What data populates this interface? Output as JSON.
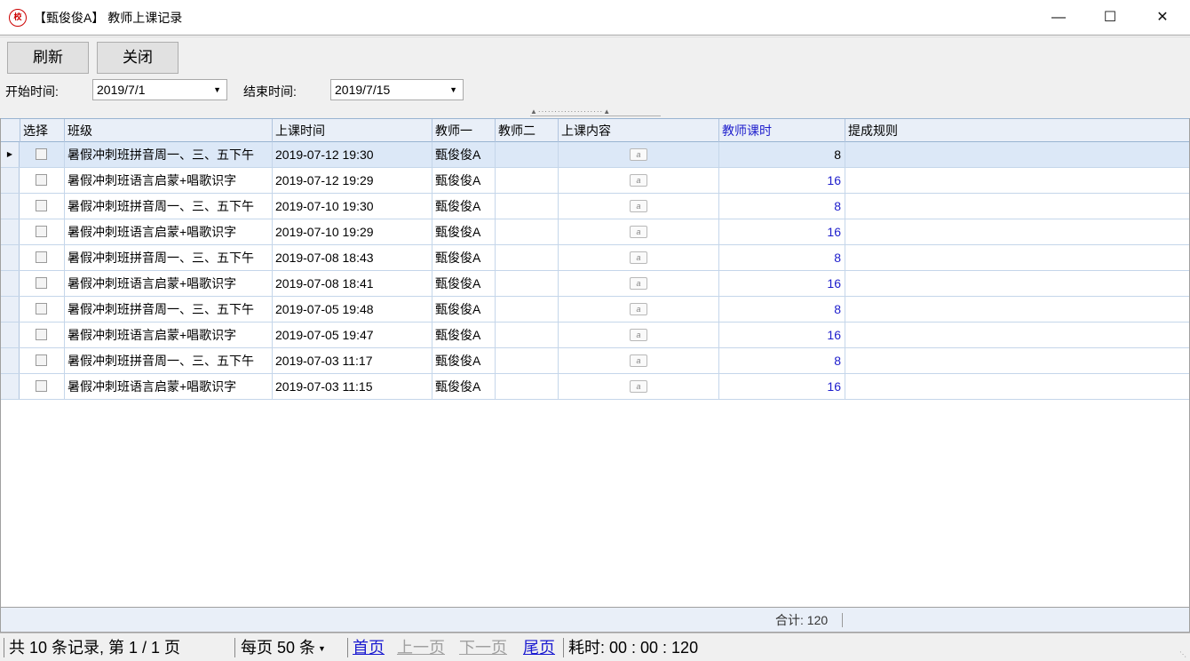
{
  "window": {
    "title": "【甄俊俊A】 教师上课记录",
    "icon_name": "app-logo-icon",
    "icon_text": "校"
  },
  "toolbar": {
    "refresh_label": "刷新",
    "close_label": "关闭"
  },
  "filters": {
    "start_label": "开始时间:",
    "start_value": "2019/7/1",
    "end_label": "结束时间:",
    "end_value": "2019/7/15"
  },
  "grid": {
    "columns": [
      "选择",
      "班级",
      "上课时间",
      "教师一",
      "教师二",
      "上课内容",
      "教师课时",
      "提成规则"
    ],
    "rows": [
      {
        "class": "暑假冲刺班拼音周一、三、五下午",
        "time": "2019-07-12 19:30",
        "teacher1": "甄俊俊A",
        "teacher2": "",
        "hours": "8",
        "rule": ""
      },
      {
        "class": "暑假冲刺班语言启蒙+唱歌识字",
        "time": "2019-07-12 19:29",
        "teacher1": "甄俊俊A",
        "teacher2": "",
        "hours": "16",
        "rule": ""
      },
      {
        "class": "暑假冲刺班拼音周一、三、五下午",
        "time": "2019-07-10 19:30",
        "teacher1": "甄俊俊A",
        "teacher2": "",
        "hours": "8",
        "rule": ""
      },
      {
        "class": "暑假冲刺班语言启蒙+唱歌识字",
        "time": "2019-07-10 19:29",
        "teacher1": "甄俊俊A",
        "teacher2": "",
        "hours": "16",
        "rule": ""
      },
      {
        "class": "暑假冲刺班拼音周一、三、五下午",
        "time": "2019-07-08 18:43",
        "teacher1": "甄俊俊A",
        "teacher2": "",
        "hours": "8",
        "rule": ""
      },
      {
        "class": "暑假冲刺班语言启蒙+唱歌识字",
        "time": "2019-07-08 18:41",
        "teacher1": "甄俊俊A",
        "teacher2": "",
        "hours": "16",
        "rule": ""
      },
      {
        "class": "暑假冲刺班拼音周一、三、五下午",
        "time": "2019-07-05 19:48",
        "teacher1": "甄俊俊A",
        "teacher2": "",
        "hours": "8",
        "rule": ""
      },
      {
        "class": "暑假冲刺班语言启蒙+唱歌识字",
        "time": "2019-07-05 19:47",
        "teacher1": "甄俊俊A",
        "teacher2": "",
        "hours": "16",
        "rule": ""
      },
      {
        "class": "暑假冲刺班拼音周一、三、五下午",
        "time": "2019-07-03 11:17",
        "teacher1": "甄俊俊A",
        "teacher2": "",
        "hours": "8",
        "rule": ""
      },
      {
        "class": "暑假冲刺班语言启蒙+唱歌识字",
        "time": "2019-07-03 11:15",
        "teacher1": "甄俊俊A",
        "teacher2": "",
        "hours": "16",
        "rule": ""
      }
    ],
    "selected_row": 0,
    "total_text": "合计: 120"
  },
  "pager": {
    "summary": "共 10 条记录, 第 1 / 1 页",
    "per_page": "每页 50 条",
    "first": "首页",
    "prev": "上一页",
    "next": "下一页",
    "last": "尾页",
    "elapsed": "耗时: 00 : 00 : 120"
  }
}
